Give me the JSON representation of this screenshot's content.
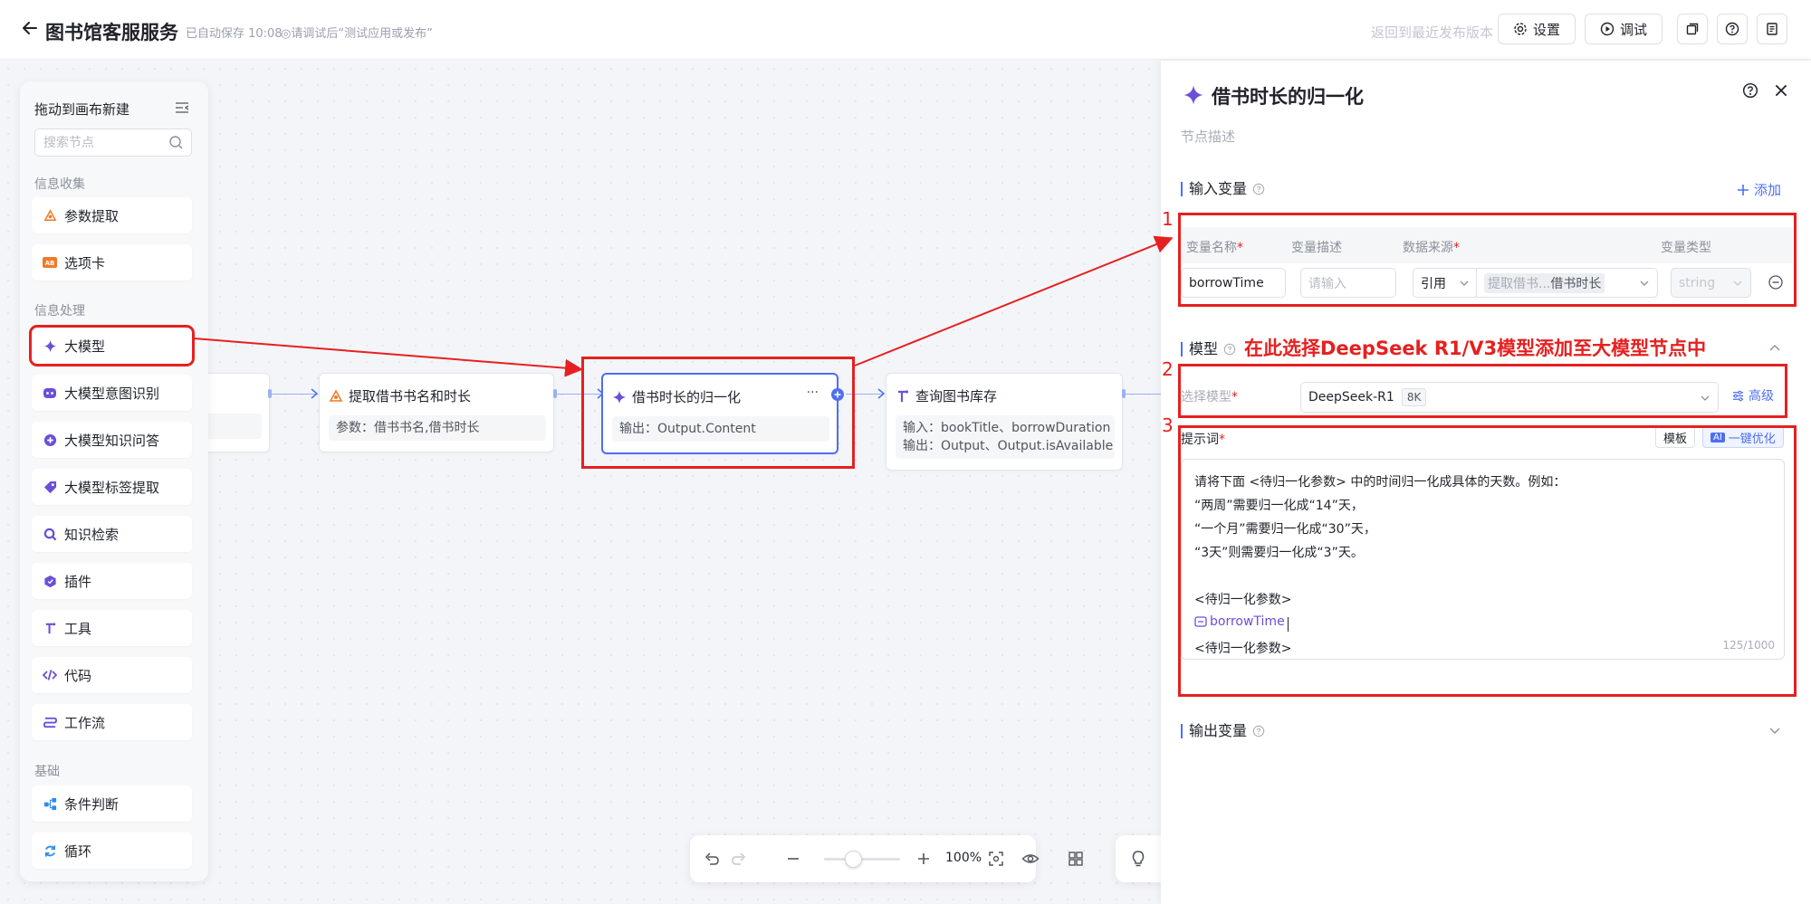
{
  "header": {
    "title": "图书馆客服服务",
    "autosave": "已自动保存 10:08",
    "hint": "◎请调试后“测试应用或发布”",
    "revert": "返回到最近发布版本",
    "settings_label": "设置",
    "debug_label": "调试"
  },
  "node_panel": {
    "title": "拖动到画布新建",
    "search_placeholder": "搜索节点",
    "sections": {
      "collect": "信息收集",
      "process": "信息处理",
      "basic": "基础"
    },
    "items": {
      "param_extract": "参数提取",
      "option_card": "选项卡",
      "llm": "大模型",
      "intent": "大模型意图识别",
      "kb_qa": "大模型知识问答",
      "tag_extract": "大模型标签提取",
      "knowledge_search": "知识检索",
      "plugin": "插件",
      "tool": "工具",
      "code": "代码",
      "workflow": "工作流",
      "condition": "条件判断",
      "loop": "循环"
    }
  },
  "flow": {
    "node_extract": {
      "title": "提取借书书名和时长",
      "body": "参数：借书书名,借书时长"
    },
    "node_normalize": {
      "title": "借书时长的归一化",
      "body": "输出：Output.Content",
      "more": "···"
    },
    "node_query": {
      "title": "查询图书库存",
      "body_line1": "输入：bookTitle、borrowDuration",
      "body_line2": "输出：Output、Output.isAvailable"
    }
  },
  "toolbar": {
    "zoom": "100%"
  },
  "panel": {
    "title": "借书时长的归一化",
    "description_placeholder": "节点描述",
    "input_section": "输入变量",
    "add_label": "添加",
    "columns": {
      "name": "变量名称",
      "desc": "变量描述",
      "source": "数据来源",
      "type": "变量类型"
    },
    "row": {
      "name": "borrowTime",
      "desc_placeholder": "请输入",
      "source_mode": "引用",
      "source_prefix": "提取借书...",
      "source_var": "借书时长",
      "type": "string"
    },
    "model_section": "模型",
    "model_annotation": "在此选择DeepSeek R1/V3模型添加至大模型节点中",
    "select_model_label": "选择模型",
    "model_name": "DeepSeek-R1",
    "model_ctx": "8K",
    "advanced_label": "高级",
    "prompt_label": "提示词",
    "template_btn": "模板",
    "optimize_btn": "一键优化",
    "ai_badge": "AI",
    "prompt_lines": [
      "请将下面 <待归一化参数> 中的时间归一化成具体的天数。例如：",
      "“两周”需要归一化成“14”天，",
      "“一个月”需要归一化成“30”天，",
      "“3天”则需要归一化成“3”天。",
      "<待归一化参数>",
      "<待归一化参数>"
    ],
    "prompt_var": "borrowTime",
    "counter": "125/1000",
    "output_section": "输出变量"
  },
  "annotations": {
    "n1": "1",
    "n2": "2",
    "n3": "3"
  },
  "colors": {
    "accent": "#4e6ef2",
    "annotation_red": "#e62020",
    "llm_purple": "#6b4fd8"
  }
}
